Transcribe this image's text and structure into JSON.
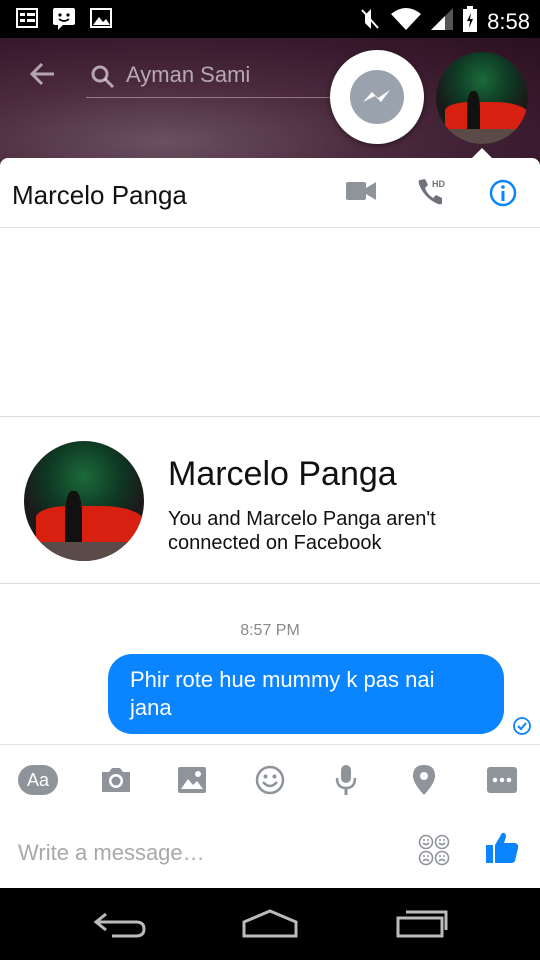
{
  "status_bar": {
    "time": "8:58",
    "left_icons": [
      "list-icon",
      "chat-smiley-icon",
      "image-icon"
    ],
    "right_icons": [
      "mute-icon",
      "wifi-icon",
      "signal-icon",
      "battery-icon"
    ]
  },
  "header": {
    "search_value": "Ayman Sami"
  },
  "conversation": {
    "contact_name": "Marcelo Panga",
    "actions": [
      "video-call-icon",
      "hd-call-icon",
      "info-icon"
    ]
  },
  "profile_card": {
    "name": "Marcelo Panga",
    "note": "You and Marcelo Panga aren't connected on Facebook"
  },
  "messages": [
    {
      "time": "8:57 PM",
      "text": "Phir rote hue mummy k pas nai jana",
      "status": "sent"
    }
  ],
  "toolbar": {
    "aa_label": "Aa",
    "tools": [
      "text-style",
      "camera",
      "gallery",
      "emoji",
      "microphone",
      "location",
      "more"
    ]
  },
  "composer": {
    "placeholder": "Write a message…"
  },
  "colors": {
    "accent": "#0a84ff",
    "icon_gray": "#8f949a"
  }
}
